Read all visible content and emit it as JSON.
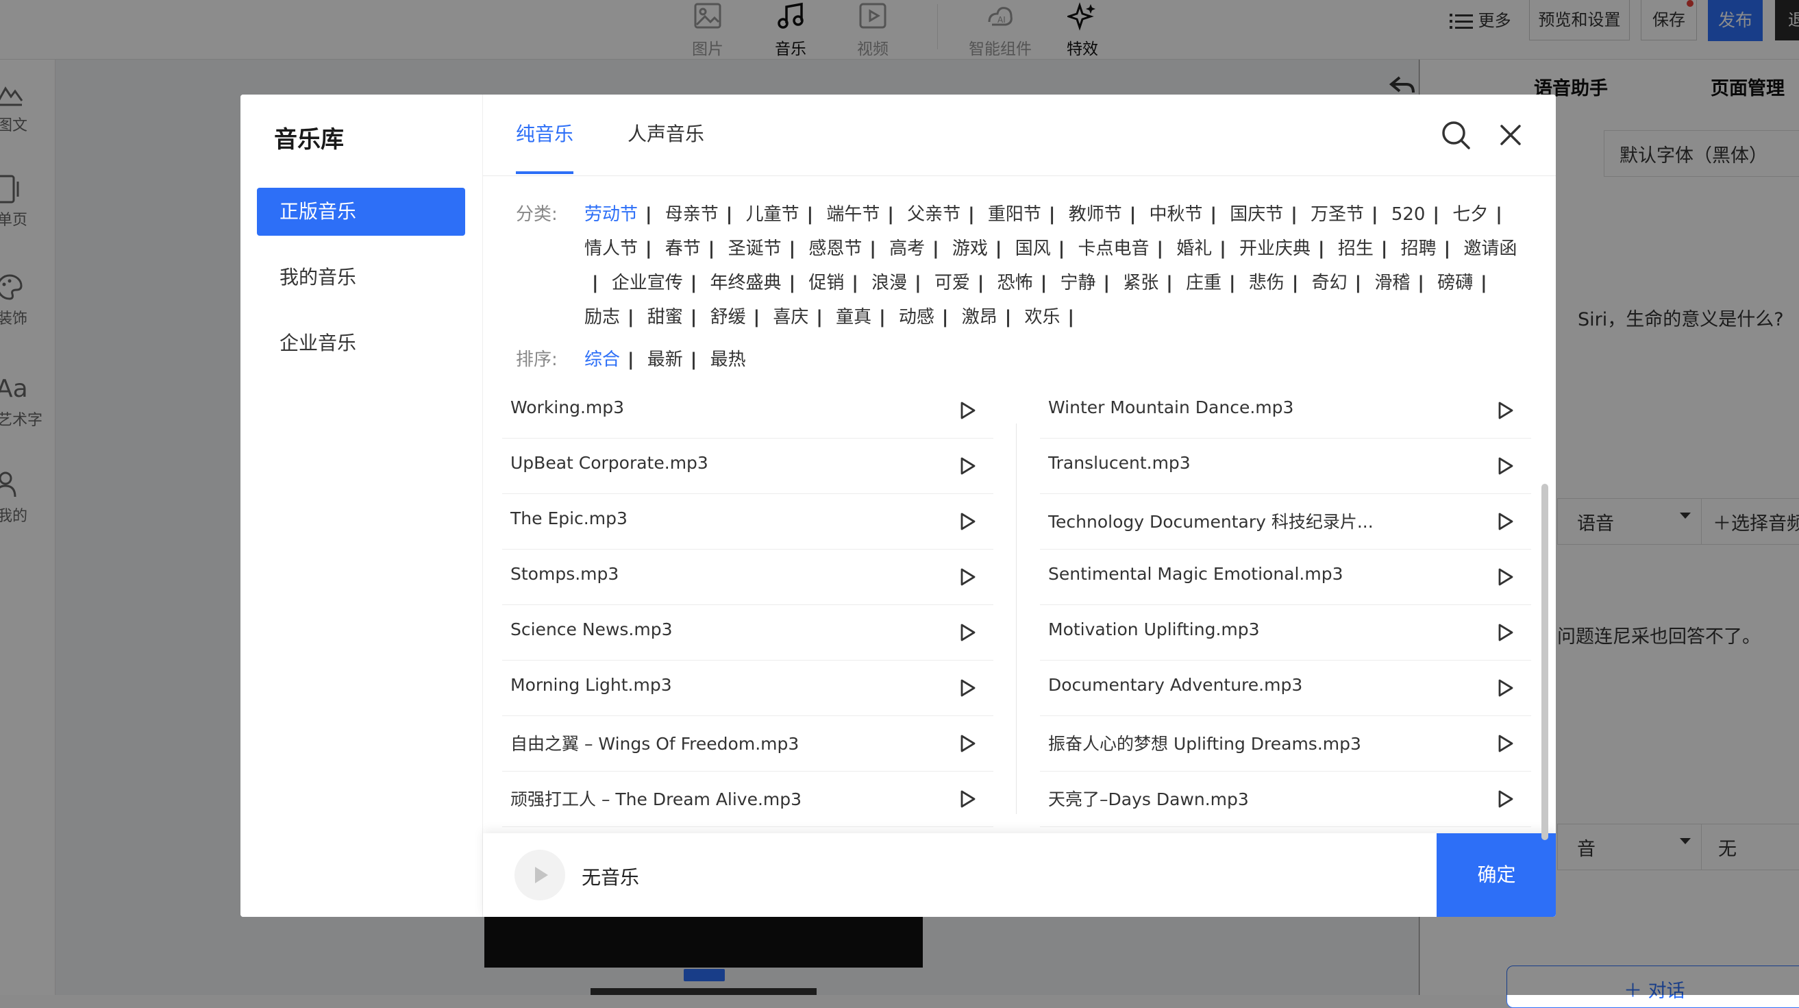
{
  "editor": {
    "tools": [
      {
        "label": "图片",
        "icon": "image-icon"
      },
      {
        "label": "音乐",
        "icon": "music-icon"
      },
      {
        "label": "视频",
        "icon": "video-icon"
      },
      {
        "label": "智能组件",
        "icon": "ai-component-icon"
      },
      {
        "label": "特效",
        "icon": "sparkle-icon"
      }
    ],
    "more_label": "更多",
    "preview_label": "预览和设置",
    "save_label": "保存",
    "publish_label": "发布",
    "exit_label": "退",
    "left_items": [
      "图文",
      "单页",
      "装饰",
      "艺术字",
      "我的"
    ],
    "right_panel": {
      "tab_voice": "语音助手",
      "tab_pages": "页面管理",
      "font_select": "默认字体（黑体）",
      "dialog_text_1": "Siri，生命的意义是什么?",
      "voice_select": "语音",
      "select_audio": "选择音频",
      "dialog_text_2": "问题连尼采也回答不了。",
      "bgm_select": "音",
      "bgm_value": "无",
      "add_dialog": "对话"
    }
  },
  "modal": {
    "title": "音乐库",
    "side_items": [
      "正版音乐",
      "我的音乐",
      "企业音乐"
    ],
    "tabs": [
      "纯音乐",
      "人声音乐"
    ],
    "category_label": "分类:",
    "categories": [
      "劳动节",
      "母亲节",
      "儿童节",
      "端午节",
      "父亲节",
      "重阳节",
      "教师节",
      "中秋节",
      "国庆节",
      "万圣节",
      "520",
      "七夕",
      "情人节",
      "春节",
      "圣诞节",
      "感恩节",
      "高考",
      "游戏",
      "国风",
      "卡点电音",
      "婚礼",
      "开业庆典",
      "招生",
      "招聘",
      "邀请函",
      "企业宣传",
      "年终盛典",
      "促销",
      "浪漫",
      "可爱",
      "恐怖",
      "宁静",
      "紧张",
      "庄重",
      "悲伤",
      "奇幻",
      "滑稽",
      "磅礴",
      "励志",
      "甜蜜",
      "舒缓",
      "喜庆",
      "童真",
      "动感",
      "激昂",
      "欢乐"
    ],
    "selected_category": "劳动节",
    "sort_label": "排序:",
    "sorts": [
      "综合",
      "最新",
      "最热"
    ],
    "selected_sort": "综合",
    "songs_left": [
      "Working.mp3",
      "UpBeat Corporate.mp3",
      "The Epic.mp3",
      "Stomps.mp3",
      "Science News.mp3",
      "Morning Light.mp3",
      "自由之翼 – Wings Of Freedom.mp3",
      "顽强打工人 – The Dream Alive.mp3"
    ],
    "songs_right": [
      "Winter Mountain Dance.mp3",
      "Translucent.mp3",
      "Technology Documentary 科技纪录片...",
      "Sentimental Magic Emotional.mp3",
      "Motivation Uplifting.mp3",
      "Documentary Adventure.mp3",
      "振奋人心的梦想 Uplifting Dreams.mp3",
      "天亮了–Days Dawn.mp3"
    ],
    "now_playing": "无音乐",
    "confirm_label": "确定"
  },
  "colors": {
    "accent": "#2d6ff7",
    "overlay": "rgba(0,0,0,0.45)"
  }
}
